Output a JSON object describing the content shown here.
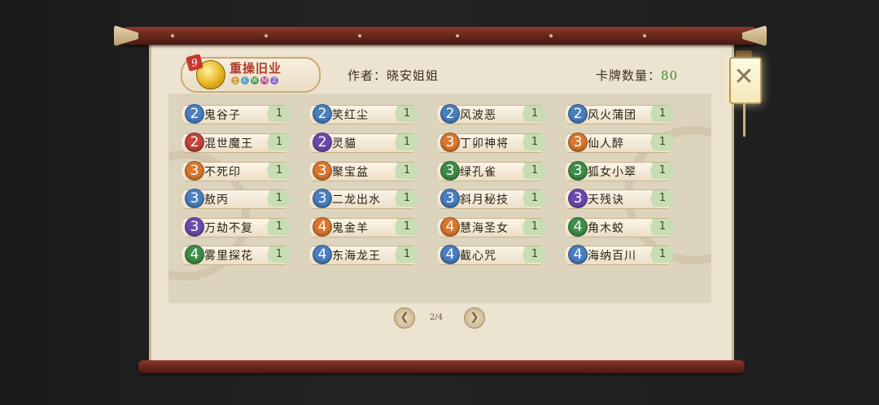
{
  "deck": {
    "badge_number": "9",
    "name": "重操旧业",
    "element_icons": [
      "土",
      "C",
      "W",
      "M",
      "Z"
    ],
    "element_colors": [
      "#d19b3a",
      "#5aa0c8",
      "#4ea05a",
      "#c04d9a",
      "#8a6ad0"
    ]
  },
  "author": "作者：晓安姐姐",
  "card_count_label": "卡牌数量：",
  "card_count_value": "80",
  "cost_colors": {
    "2": "#4a7fc0",
    "3": "#d9782d",
    "4": "#3f8e4a"
  },
  "cards": [
    {
      "cost": "2",
      "color": "#4a7fc0",
      "name": "鬼谷子",
      "qty": "1"
    },
    {
      "cost": "2",
      "color": "#4a7fc0",
      "name": "笑红尘",
      "qty": "1"
    },
    {
      "cost": "2",
      "color": "#4a7fc0",
      "name": "风波恶",
      "qty": "1"
    },
    {
      "cost": "2",
      "color": "#4a7fc0",
      "name": "风火蒲团",
      "qty": "1"
    },
    {
      "cost": "2",
      "color": "#c2453a",
      "name": "混世魔王",
      "qty": "1"
    },
    {
      "cost": "2",
      "color": "#6b4ab0",
      "name": "灵貓",
      "qty": "1"
    },
    {
      "cost": "3",
      "color": "#d9782d",
      "name": "丁卯神将",
      "qty": "1"
    },
    {
      "cost": "3",
      "color": "#d9782d",
      "name": "仙人醉",
      "qty": "1"
    },
    {
      "cost": "3",
      "color": "#d9782d",
      "name": "不死印",
      "qty": "1"
    },
    {
      "cost": "3",
      "color": "#d9782d",
      "name": "聚宝盆",
      "qty": "1"
    },
    {
      "cost": "3",
      "color": "#3f8e4a",
      "name": "绿孔雀",
      "qty": "1"
    },
    {
      "cost": "3",
      "color": "#3f8e4a",
      "name": "狐女小翠",
      "qty": "1"
    },
    {
      "cost": "3",
      "color": "#4a7fc0",
      "name": "敖丙",
      "qty": "1"
    },
    {
      "cost": "3",
      "color": "#4a7fc0",
      "name": "二龙出水",
      "qty": "1"
    },
    {
      "cost": "3",
      "color": "#4a7fc0",
      "name": "斜月秘技",
      "qty": "1"
    },
    {
      "cost": "3",
      "color": "#6b4ab0",
      "name": "天残诀",
      "qty": "1"
    },
    {
      "cost": "3",
      "color": "#6b4ab0",
      "name": "万劫不复",
      "qty": "1"
    },
    {
      "cost": "4",
      "color": "#d9782d",
      "name": "鬼金羊",
      "qty": "1"
    },
    {
      "cost": "4",
      "color": "#d9782d",
      "name": "慧海圣女",
      "qty": "1"
    },
    {
      "cost": "4",
      "color": "#3f8e4a",
      "name": "角木蛟",
      "qty": "1"
    },
    {
      "cost": "4",
      "color": "#3f8e4a",
      "name": "雾里探花",
      "qty": "1"
    },
    {
      "cost": "4",
      "color": "#4a7fc0",
      "name": "东海龙王",
      "qty": "1"
    },
    {
      "cost": "4",
      "color": "#4a7fc0",
      "name": "截心咒",
      "qty": "1"
    },
    {
      "cost": "4",
      "color": "#4a7fc0",
      "name": "海纳百川",
      "qty": "1"
    }
  ],
  "pager": {
    "text": "2/4",
    "prev_icon": "prev-arrow-icon",
    "next_icon": "next-arrow-icon"
  },
  "close_icon": "close-icon"
}
